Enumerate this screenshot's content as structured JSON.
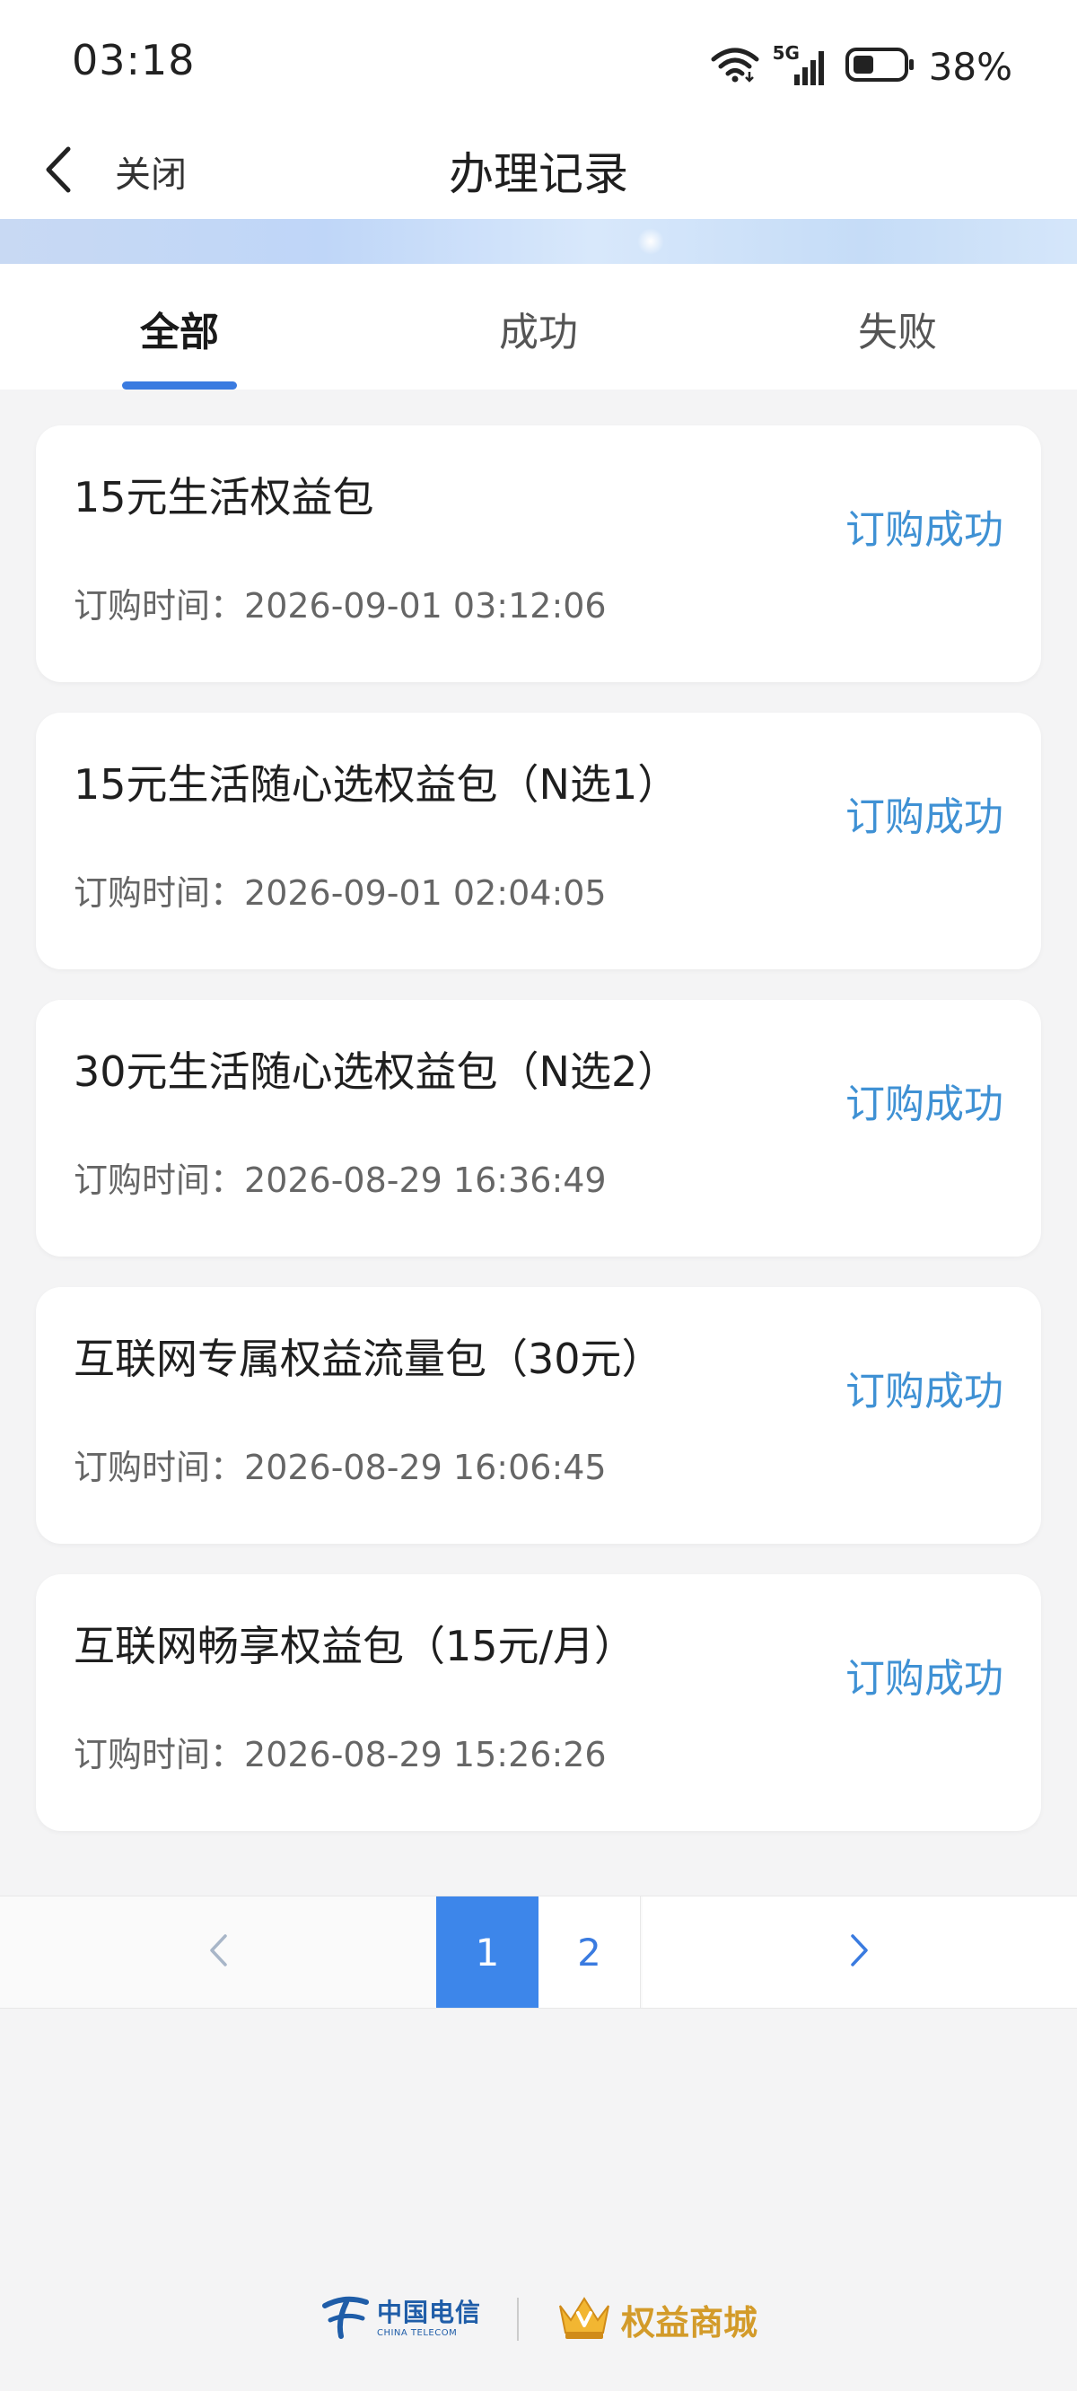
{
  "status_bar": {
    "time": "03:18",
    "network": "5G",
    "battery": "38%"
  },
  "nav": {
    "close_label": "关闭",
    "title": "办理记录"
  },
  "tabs": [
    {
      "label": "全部",
      "active": true
    },
    {
      "label": "成功",
      "active": false
    },
    {
      "label": "失败",
      "active": false
    }
  ],
  "records": [
    {
      "title": "15元生活权益包",
      "time_label": "订购时间：",
      "time": "2026-09-01 03:12:06",
      "status": "订购成功"
    },
    {
      "title": "15元生活随心选权益包（N选1）",
      "time_label": "订购时间：",
      "time": "2026-09-01 02:04:05",
      "status": "订购成功"
    },
    {
      "title": "30元生活随心选权益包（N选2）",
      "time_label": "订购时间：",
      "time": "2026-08-29 16:36:49",
      "status": "订购成功"
    },
    {
      "title": "互联网专属权益流量包（30元）",
      "time_label": "订购时间：",
      "time": "2026-08-29 16:06:45",
      "status": "订购成功"
    },
    {
      "title": "互联网畅享权益包（15元/月）",
      "time_label": "订购时间：",
      "time": "2026-08-29 15:26:26",
      "status": "订购成功"
    }
  ],
  "pagination": {
    "pages": [
      "1",
      "2"
    ],
    "current": "1"
  },
  "footer": {
    "telecom_cn": "中国电信",
    "telecom_en": "CHINA TELECOM",
    "mall_label": "权益商城"
  },
  "colors": {
    "accent": "#3a7be0",
    "status_success": "#3f91d4",
    "page_active_bg": "#3d86ea",
    "mall_gold": "#d39b2a"
  }
}
